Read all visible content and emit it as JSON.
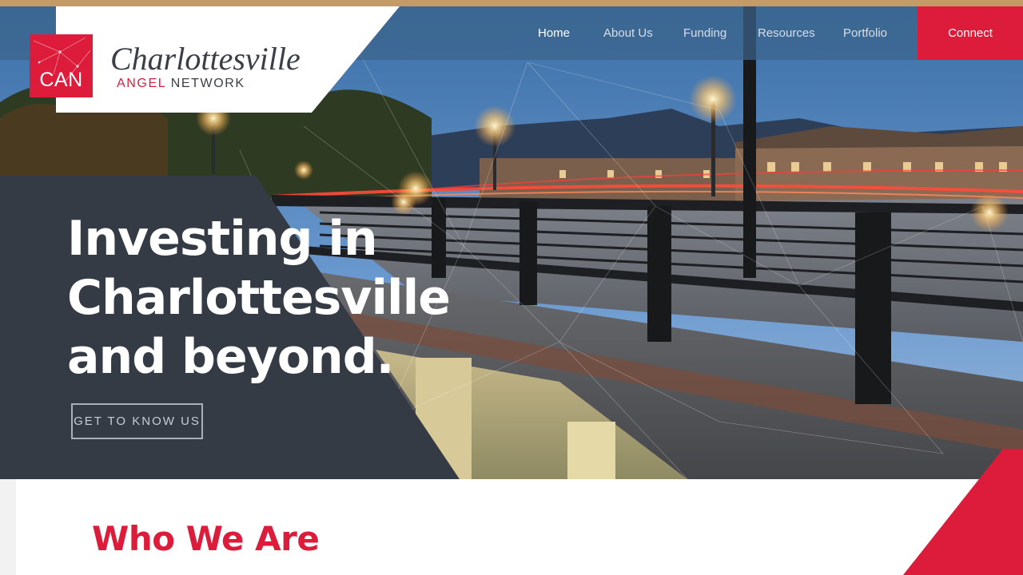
{
  "brand": {
    "logo_mark": "CAN",
    "name": "Charlottesville",
    "sub_angel": "ANGEL",
    "sub_network": "NETWORK",
    "color_red": "#dc1c3a",
    "color_gold": "#c49a66"
  },
  "nav": {
    "items": [
      {
        "label": "Home"
      },
      {
        "label": "About Us"
      },
      {
        "label": "Funding"
      },
      {
        "label": "Resources"
      },
      {
        "label": "Portfolio"
      }
    ],
    "active": "Home",
    "connect_label": "Connect"
  },
  "hero": {
    "headline_lines": [
      "Investing in",
      "Charlottesville",
      "and beyond."
    ],
    "cta_label": "GET TO KNOW US"
  },
  "section": {
    "title": "Who We Are"
  }
}
